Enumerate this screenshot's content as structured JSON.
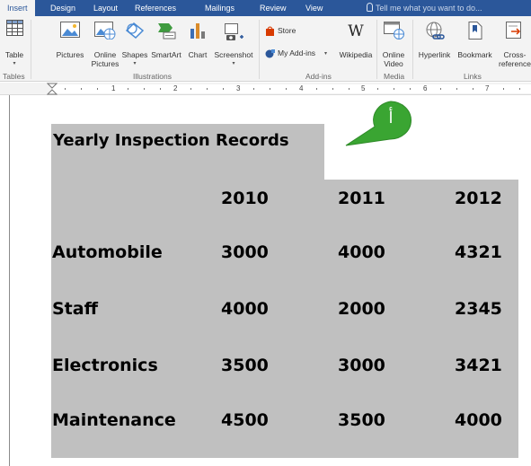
{
  "ribbon": {
    "tabs": [
      "Insert",
      "Design",
      "Layout",
      "References",
      "Mailings",
      "Review",
      "View"
    ],
    "tell_me": "Tell me what you want to do...",
    "buttons": {
      "table": "Table",
      "pictures": "Pictures",
      "online_pictures_1": "Online",
      "online_pictures_2": "Pictures",
      "shapes": "Shapes",
      "smartart": "SmartArt",
      "chart": "Chart",
      "screenshot": "Screenshot",
      "store": "Store",
      "my_addins": "My Add-ins",
      "wikipedia": "Wikipedia",
      "online_video_1": "Online",
      "online_video_2": "Video",
      "hyperlink": "Hyperlink",
      "bookmark": "Bookmark",
      "cross_reference_1": "Cross-",
      "cross_reference_2": "reference"
    },
    "groups": {
      "tables": "Tables",
      "illustrations": "Illustrations",
      "addins": "Add-ins",
      "media": "Media",
      "links": "Links"
    },
    "wiki_glyph": "W"
  },
  "ruler": {
    "numbers": [
      "1",
      "2",
      "3",
      "4",
      "5",
      "6",
      "7"
    ]
  },
  "document": {
    "title": "Yearly Inspection Records",
    "years": [
      "2010",
      "2011",
      "2012"
    ],
    "rows": [
      {
        "label": "Automobile",
        "values": [
          "3000",
          "4000",
          "4321"
        ]
      },
      {
        "label": "Staff",
        "values": [
          "4000",
          "2000",
          "2345"
        ]
      },
      {
        "label": "Electronics",
        "values": [
          "3500",
          "3000",
          "3421"
        ]
      },
      {
        "label": "Maintenance",
        "values": [
          "4500",
          "3500",
          "4000"
        ]
      }
    ],
    "shade_color": "#c0c0c0"
  },
  "callout": {
    "label": "أ",
    "color": "#3aa532"
  },
  "colors": {
    "ribbon_tab_bar": "#2b579a",
    "ribbon_bg": "#f3f3f3"
  }
}
